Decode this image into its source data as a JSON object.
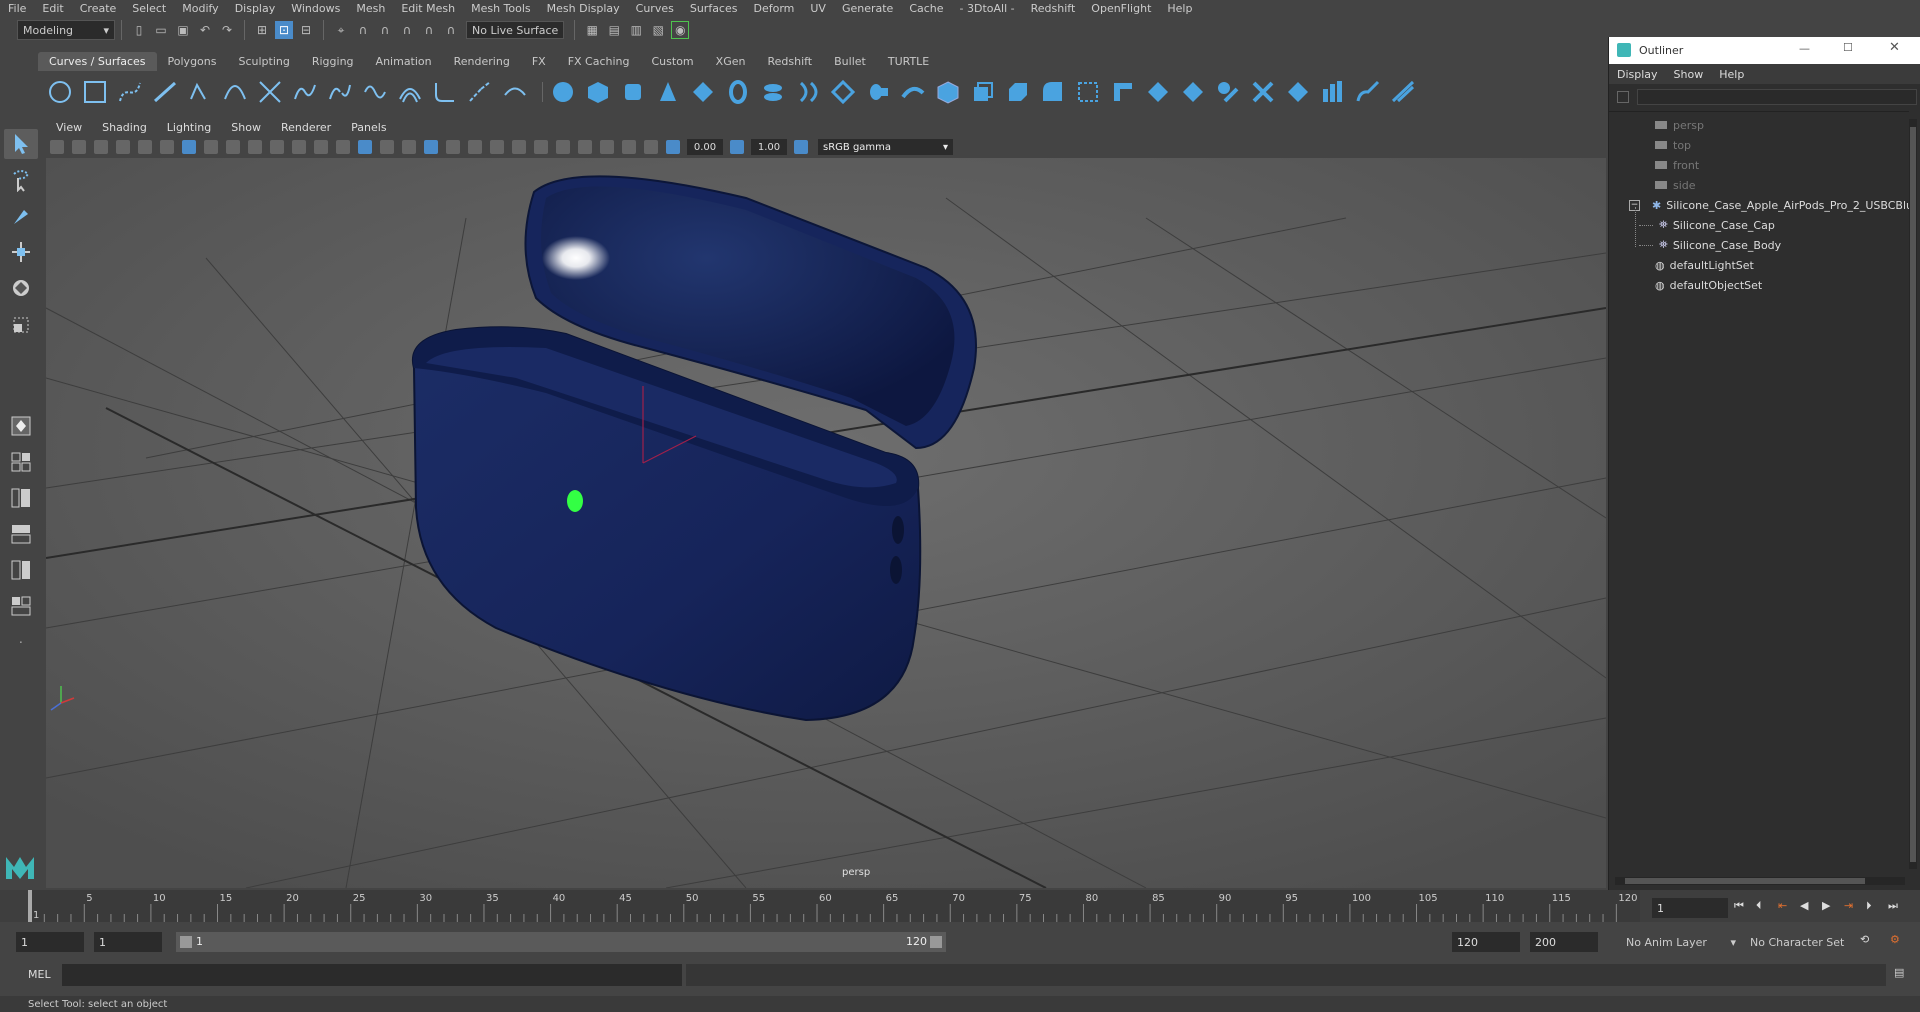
{
  "menubar": {
    "items": [
      "File",
      "Edit",
      "Create",
      "Select",
      "Modify",
      "Display",
      "Windows",
      "Mesh",
      "Edit Mesh",
      "Mesh Tools",
      "Mesh Display",
      "Curves",
      "Surfaces",
      "Deform",
      "UV",
      "Generate",
      "Cache",
      "- 3DtoAll -",
      "Redshift",
      "OpenFlight",
      "Help"
    ]
  },
  "status_line": {
    "mode": "Modeling",
    "live_surface": "No Live Surface"
  },
  "shelf": {
    "tabs": [
      "Curves / Surfaces",
      "Polygons",
      "Sculpting",
      "Rigging",
      "Animation",
      "Rendering",
      "FX",
      "FX Caching",
      "Custom",
      "XGen",
      "Redshift",
      "Bullet",
      "TURTLE"
    ],
    "active_tab": "Curves / Surfaces"
  },
  "panel": {
    "menus": [
      "View",
      "Shading",
      "Lighting",
      "Show",
      "Renderer",
      "Panels"
    ],
    "exposure": "0.00",
    "gamma": "1.00",
    "color_space": "sRGB gamma",
    "camera_label": "persp"
  },
  "outliner": {
    "title": "Outliner",
    "menus": [
      "Display",
      "Show",
      "Help"
    ],
    "cameras": [
      "persp",
      "top",
      "front",
      "side"
    ],
    "group": "Silicone_Case_Apple_AirPods_Pro_2_USBCBlu",
    "children": [
      "Silicone_Case_Cap",
      "Silicone_Case_Body"
    ],
    "sets": [
      "defaultLightSet",
      "defaultObjectSet"
    ]
  },
  "timeline": {
    "ticks": [
      "1",
      "5",
      "10",
      "15",
      "20",
      "25",
      "30",
      "35",
      "40",
      "45",
      "50",
      "55",
      "60",
      "65",
      "70",
      "75",
      "80",
      "85",
      "90",
      "95",
      "100",
      "105",
      "110",
      "115",
      "120"
    ],
    "current_frame": "1"
  },
  "range": {
    "start": "1",
    "start2": "1",
    "slider_start": "1",
    "slider_end": "120",
    "end": "120",
    "end2": "200",
    "anim_layer": "No Anim Layer",
    "char_set": "No Character Set"
  },
  "mel": {
    "label": "MEL"
  },
  "status": {
    "help": "Select Tool: select an object"
  },
  "colors": {
    "case": "#1b2b5e",
    "accent": "#4a8bc9",
    "viewport": "#595959"
  }
}
